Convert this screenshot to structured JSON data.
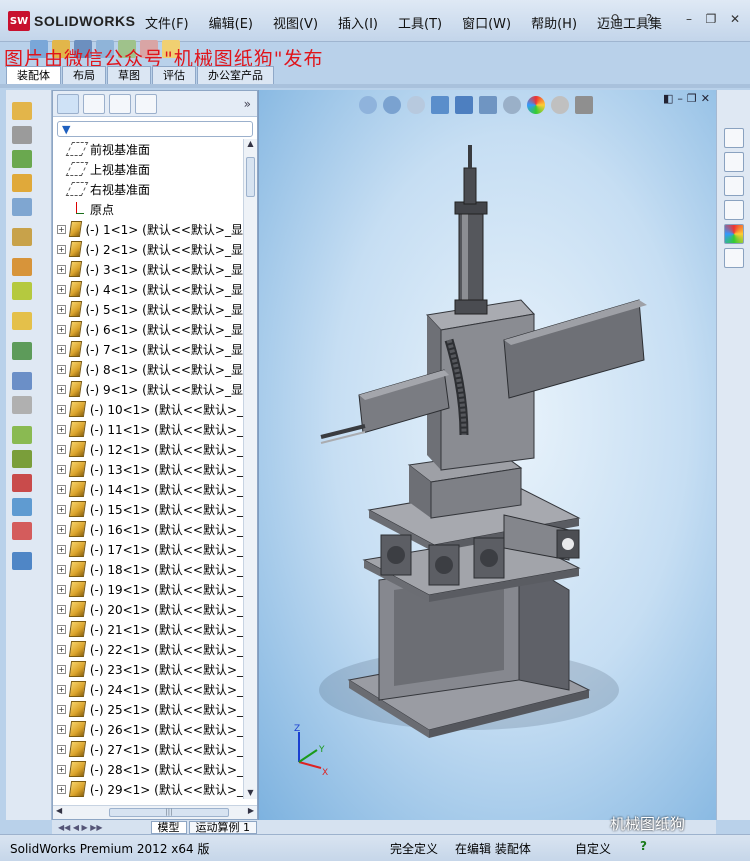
{
  "app": {
    "brand": "SOLIDWORKS",
    "badge": "SW"
  },
  "menu": [
    "文件(F)",
    "编辑(E)",
    "视图(V)",
    "插入(I)",
    "工具(T)",
    "窗口(W)",
    "帮助(H)",
    "迈迪工具集"
  ],
  "watermark_top": "图片由微信公众号\"机械图纸狗\"发布",
  "watermark_bottom": "机械图纸狗",
  "command_tabs": [
    "装配体",
    "布局",
    "草图",
    "评估",
    "办公室产品"
  ],
  "active_command_tab": "装配体",
  "tree": {
    "planes": [
      "前视基准面",
      "上视基准面",
      "右视基准面"
    ],
    "origin": "原点",
    "components": [
      "(-) 1<1> (默认<<默认>_显",
      "(-) 2<1> (默认<<默认>_显",
      "(-) 3<1> (默认<<默认>_显",
      "(-) 4<1> (默认<<默认>_显",
      "(-) 5<1> (默认<<默认>_显",
      "(-) 6<1> (默认<<默认>_显",
      "(-) 7<1> (默认<<默认>_显",
      "(-) 8<1> (默认<<默认>_显",
      "(-) 9<1> (默认<<默认>_显",
      "(-) 10<1> (默认<<默认>_",
      "(-) 11<1> (默认<<默认>_",
      "(-) 12<1> (默认<<默认>_",
      "(-) 13<1> (默认<<默认>_",
      "(-) 14<1> (默认<<默认>_",
      "(-) 15<1> (默认<<默认>_",
      "(-) 16<1> (默认<<默认>_",
      "(-) 17<1> (默认<<默认>_",
      "(-) 18<1> (默认<<默认>_",
      "(-) 19<1> (默认<<默认>_",
      "(-) 20<1> (默认<<默认>_",
      "(-) 21<1> (默认<<默认>_",
      "(-) 22<1> (默认<<默认>_",
      "(-) 23<1> (默认<<默认>_",
      "(-) 24<1> (默认<<默认>_",
      "(-) 25<1> (默认<<默认>_",
      "(-) 26<1> (默认<<默认>_",
      "(-) 27<1> (默认<<默认>_",
      "(-) 28<1> (默认<<默认>_",
      "(-) 29<1> (默认<<默认>_"
    ]
  },
  "bottom_tabs": [
    "模型",
    "运动算例 1"
  ],
  "status": {
    "product": "SolidWorks Premium 2012 x64 版",
    "definition": "完全定义",
    "editing": "在编辑 装配体",
    "units": "自定义"
  },
  "axis_labels": {
    "x": "X",
    "y": "Y",
    "z": "Z"
  },
  "colors": {
    "accent": "#c8102e",
    "watermark": "#e0141b",
    "viewport_bg": "#c6def3",
    "model": "#7d7f87"
  }
}
